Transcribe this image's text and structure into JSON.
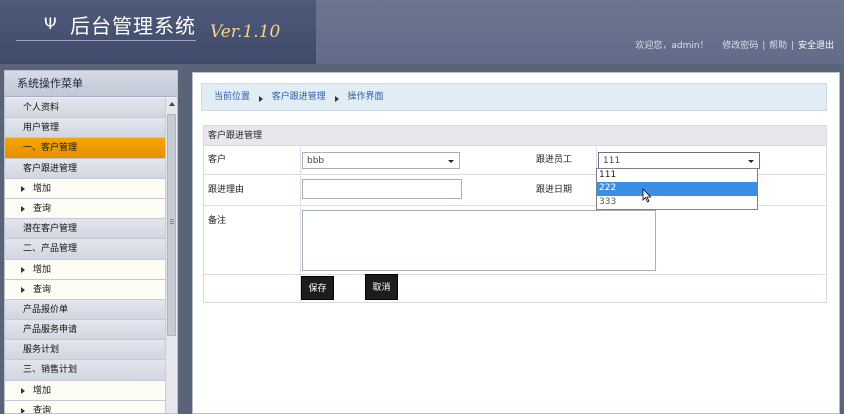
{
  "header": {
    "logo_glyph": "Ψ",
    "title": "后台管理系统",
    "version": "Ver.1.10",
    "links": {
      "welcome": "欢迎您，admin！",
      "change_password": "修改密码",
      "help": "帮助",
      "logout": "安全退出"
    }
  },
  "sidebar": {
    "title": "系统操作菜单",
    "items": [
      {
        "label": "个人资料",
        "kind": "section"
      },
      {
        "label": "用户管理",
        "kind": "section"
      },
      {
        "label": "一、客户管理",
        "kind": "active"
      },
      {
        "label": "客户跟进管理",
        "kind": "section"
      },
      {
        "label": "增加",
        "kind": "sub"
      },
      {
        "label": "查询",
        "kind": "sub"
      },
      {
        "label": "潜在客户管理",
        "kind": "section"
      },
      {
        "label": "二、产品管理",
        "kind": "section"
      },
      {
        "label": "增加",
        "kind": "sub"
      },
      {
        "label": "查询",
        "kind": "sub"
      },
      {
        "label": "产品报价单",
        "kind": "section"
      },
      {
        "label": "产品服务申请",
        "kind": "section"
      },
      {
        "label": "服务计划",
        "kind": "section"
      },
      {
        "label": "三、销售计划",
        "kind": "section"
      },
      {
        "label": "增加",
        "kind": "sub"
      },
      {
        "label": "查询",
        "kind": "sub"
      }
    ]
  },
  "breadcrumb": {
    "items": [
      "当前位置",
      "客户跟进管理",
      "操作界面"
    ]
  },
  "form": {
    "title": "客户跟进管理",
    "customer_label": "客户",
    "customer_value": "bbb",
    "employee_label": "跟进员工",
    "employee_value": "111",
    "reason_label": "跟进理由",
    "reason_value": "",
    "date_label": "跟进日期",
    "remark_label": "备注",
    "remark_value": "",
    "save_label": "保存",
    "cancel_label": "取消"
  },
  "dropdown": {
    "options": [
      "111",
      "222",
      "333"
    ],
    "highlighted_index": 1
  },
  "colors": {
    "active_menu": "#f6a600",
    "highlight": "#3a8ee6",
    "version_text": "#f3d58a"
  }
}
